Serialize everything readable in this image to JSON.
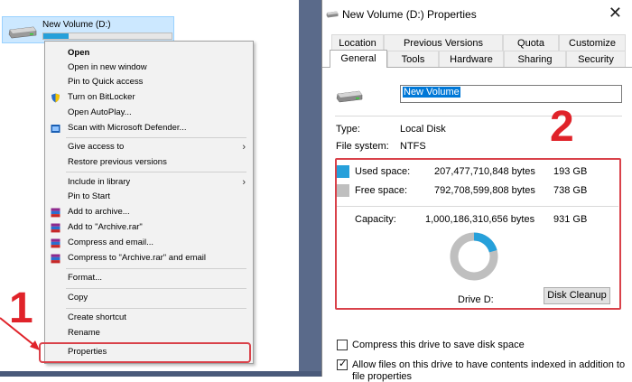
{
  "explorer": {
    "drive_label": "New Volume (D:)",
    "drive_fill_fraction": 0.2
  },
  "context_menu": {
    "items": [
      {
        "label": "Open",
        "bold": true
      },
      {
        "label": "Open in new window"
      },
      {
        "label": "Pin to Quick access"
      },
      {
        "label": "Turn on BitLocker",
        "icon": "shield-icon"
      },
      {
        "label": "Open AutoPlay..."
      },
      {
        "label": "Scan with Microsoft Defender...",
        "icon": "defender-icon"
      },
      {
        "label": "Give access to",
        "submenu": true
      },
      {
        "label": "Restore previous versions"
      },
      {
        "label": "Include in library",
        "submenu": true
      },
      {
        "label": "Pin to Start"
      },
      {
        "label": "Add to archive...",
        "icon": "winrar-icon"
      },
      {
        "label": "Add to \"Archive.rar\"",
        "icon": "winrar-icon"
      },
      {
        "label": "Compress and email...",
        "icon": "winrar-icon"
      },
      {
        "label": "Compress to \"Archive.rar\" and email",
        "icon": "winrar-icon"
      },
      {
        "label": "Format..."
      },
      {
        "label": "Copy"
      },
      {
        "label": "Create shortcut"
      },
      {
        "label": "Rename"
      },
      {
        "label": "Properties"
      }
    ],
    "step_number": "1"
  },
  "dialog": {
    "title": "New Volume (D:) Properties",
    "close_glyph": "✕",
    "tabs_row1": [
      "Location",
      "Previous Versions",
      "Quota",
      "Customize"
    ],
    "tabs_row2": [
      "General",
      "Tools",
      "Hardware",
      "Sharing",
      "Security"
    ],
    "active_tab": "General",
    "volume_name": "New Volume",
    "type_label": "Type:",
    "type_value": "Local Disk",
    "fs_label": "File system:",
    "fs_value": "NTFS",
    "used_label": "Used space:",
    "used_bytes": "207,477,710,848 bytes",
    "used_gb": "193 GB",
    "free_label": "Free space:",
    "free_bytes": "792,708,599,808 bytes",
    "free_gb": "738 GB",
    "capacity_label": "Capacity:",
    "capacity_bytes": "1,000,186,310,656 bytes",
    "capacity_gb": "931 GB",
    "drive_caption": "Drive D:",
    "cleanup_label": "Disk Cleanup",
    "compress_label": "Compress this drive to save disk space",
    "index_label": "Allow files on this drive to have contents indexed in addition to",
    "index_label_cont": "file properties",
    "used_fraction": 0.207,
    "used_color": "#26a0da",
    "free_color": "#bfbfbf",
    "step_number": "2"
  }
}
